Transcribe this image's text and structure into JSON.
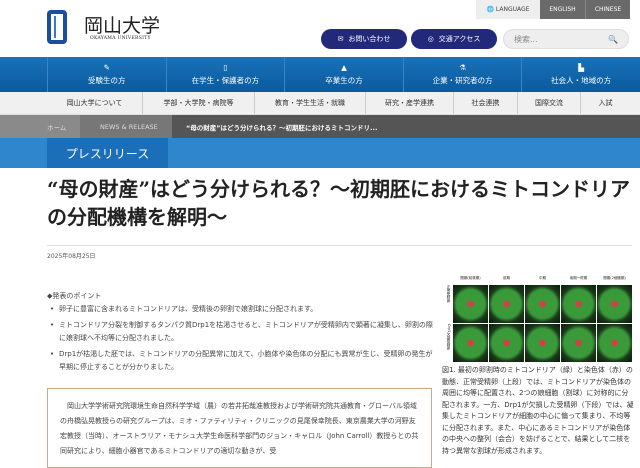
{
  "header": {
    "logo_jp": "岡山大学",
    "logo_en": "OKAYAMA UNIVERSITY",
    "language": "LANGUAGE",
    "english": "ENGLISH",
    "chinese": "CHINESE",
    "contact": "お問い合わせ",
    "access": "交通アクセス",
    "search_placeholder": "検索..."
  },
  "nav_primary": [
    "受験生の方",
    "在学生・保護者の方",
    "卒業生の方",
    "企業・研究者の方",
    "社会人・地域の方"
  ],
  "nav_secondary": [
    "岡山大学について",
    "学部・大学院・病院等",
    "教育・学生生活・就職",
    "研究・産学連携",
    "社会連携",
    "国際交流",
    "入試"
  ],
  "breadcrumb": {
    "home": "ホーム",
    "section": "NEWS & RELEASE",
    "current": "“母の財産”はどう分けられる？～初期胚におけるミトコンドリ..."
  },
  "section_label": "プレスリリース",
  "article": {
    "title": "“母の財産”はどう分けられる？～初期胚におけるミトコンドリアの分配機構を解明～",
    "date": "2025年08月25日",
    "points_heading": "◆発表のポイント",
    "points": [
      "卵子に豊富に含まれるミトコンドリアは、受精後の卵割で娘割球に分配されます。",
      "ミトコンドリア分裂を制御するタンパク質Drp1を枯渇させると、ミトコンドリアが受精卵内で顕著に凝集し、卵割の際に娘割球へ不均等に分配されました。",
      "Drp1が枯渇した胚では、ミトコンドリアの分配異常に加えて、小胞体や染色体の分配にも異常が生じ、受精卵の発生が早期に停止することが分かりました。"
    ],
    "summary": "岡山大学学術研究院環境生命自然科学学域（農）の若井拓哉准教授および学術研究院共通教育・グローバル領域の舟橋弘晃教授らの研究グループは、ミオ・ファティリティ・クリニックの見尾保幸院長、東京農業大学の河野友宏教授（当時）、オーストラリア・モナシュ大学生命医科学部門のジョン・キャロル（John Carroll）教授らとの共同研究により、細胞小器官であるミトコンドリアの適切な動きが、受",
    "figure": {
      "columns": [
        "間期(前核期)",
        "前期",
        "中期",
        "後期～終期",
        "間期(2細胞期)"
      ],
      "rows": [
        "正常受精卵",
        "Drp1欠損受精卵"
      ],
      "caption": "図1. 最初の卵割時のミトコンドリア（緑）と染色体（赤）の動態．正常受精卵（上段）では、ミトコンドリアが染色体の周囲に均等に配置され、2つの娘細胞（割球）に対称的に分配されます。一方、Drp1が欠損した受精卵（下段）では、凝集したミトコンドリアが細胞の中心に偏って集まり、不均等に分配されます。また、中心にあるミトコンドリアが染色体の中央への整列（会合）を妨げることで、結果として二核を持つ異常な割球が形成されます。"
    }
  }
}
